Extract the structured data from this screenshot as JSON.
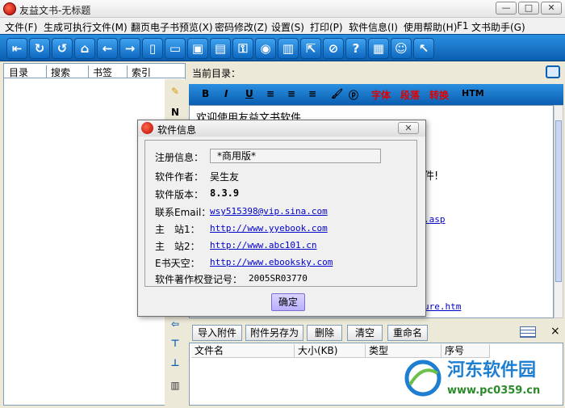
{
  "window": {
    "title": "友益文书-无标题",
    "minimize": "—",
    "restore": "□",
    "close": "✕"
  },
  "menu": [
    "文件(F)",
    "生成可执行文件(M)",
    "翻页电子书预览(X)",
    "密码修改(Z)",
    "设置(S)",
    "打印(P)",
    "软件信息(I)",
    "使用帮助(H)",
    "F1",
    "文书助手(G)"
  ],
  "toolbar_icons": [
    "exit-icon",
    "redo-icon",
    "undo-icon",
    "home-icon",
    "back-icon",
    "forward-icon",
    "new-document-icon",
    "open-folder-icon",
    "save-icon",
    "save-as-icon",
    "password-icon",
    "camera-icon",
    "clipboard-icon",
    "export-icon",
    "disable-icon",
    "help-icon",
    "document-icon",
    "smiley-icon",
    "pointer-icon"
  ],
  "left_tabs": [
    "目录",
    "搜索",
    "书签",
    "索引"
  ],
  "current_dir_label": "当前目录：",
  "format_bar": {
    "bold": "B",
    "italic": "I",
    "underline": "U",
    "align_left": "≡",
    "align_center": "≡",
    "align_right": "≡",
    "font": "字体",
    "paragraph": "段落",
    "convert": "转换",
    "html": "HTM"
  },
  "editor": {
    "lines": [
      "欢迎使用友益文书软件",
      "件!",
      ".asp",
      "ure.htm"
    ]
  },
  "attachments": {
    "buttons": [
      "导入附件",
      "附件另存为",
      "删除",
      "清空",
      "重命名"
    ],
    "columns": [
      "文件名",
      "大小(KB)",
      "类型",
      "序号"
    ],
    "close": "×"
  },
  "dialog": {
    "title": "软件信息",
    "close": "✕",
    "registration_label": "注册信息：",
    "registration_value": "*商用版*",
    "author_label": "软件作者：",
    "author_value": "吴生友",
    "version_label": "软件版本：",
    "version_value": "8.3.9",
    "email_label": "联系Email：",
    "email_value": "wsy515398@vip.sina.com",
    "site1_label": "主　站1：",
    "site1_value": "http://www.yyebook.com",
    "site2_label": "主　站2：",
    "site2_value": "http://www.abc101.cn",
    "esky_label": "E书天空：",
    "esky_value": "http://www.ebooksky.com",
    "copyright_label": "软件著作权登记号：",
    "copyright_value": "2005SR03770",
    "ok_button": "确定"
  },
  "watermark": {
    "brand": "河东软件园",
    "url": "www.pc0359.cn"
  },
  "colors": {
    "toolbar": "#0b5eb0",
    "link": "#0000cc",
    "red_text": "#e00000"
  }
}
